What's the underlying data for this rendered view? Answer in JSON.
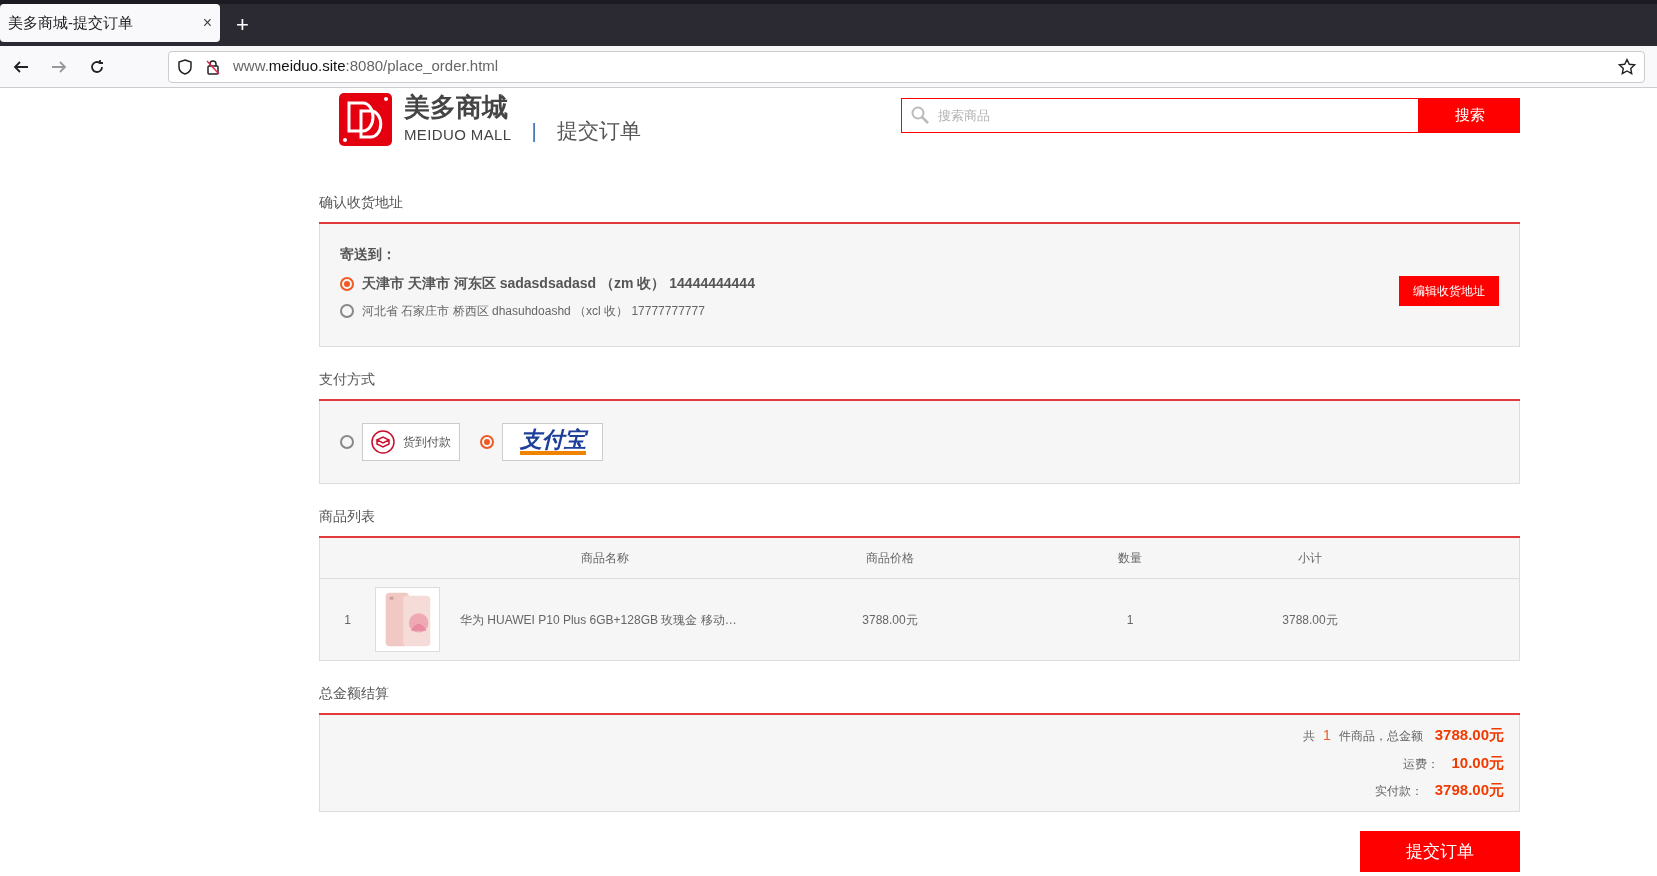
{
  "browser": {
    "tab_title": "美多商城-提交订单",
    "url_prefix": "www.",
    "url_domain": "meiduo.site",
    "url_rest": ":8080/place_order.html",
    "new_tab": "+",
    "close": "×"
  },
  "header": {
    "logo_cn": "美多商城",
    "logo_en": "MEIDUO MALL",
    "separator": "|",
    "page_title": "提交订单",
    "search": {
      "placeholder": "搜索商品",
      "button": "搜索"
    }
  },
  "address": {
    "title": "确认收货地址",
    "send_to": "寄送到：",
    "edit_button": "编辑收货地址",
    "items": [
      {
        "text": "天津市 天津市 河东区 sadasdsadasd （zm 收） 14444444444",
        "selected": true
      },
      {
        "text": "河北省 石家庄市 桥西区 dhasuhdoashd （xcl 收） 17777777777",
        "selected": false
      }
    ]
  },
  "payment": {
    "title": "支付方式",
    "options": [
      {
        "kind": "cod",
        "label": "货到付款",
        "selected": false
      },
      {
        "kind": "alipay",
        "label": "支付宝",
        "selected": true
      }
    ]
  },
  "goods": {
    "title": "商品列表",
    "columns": [
      "商品名称",
      "商品价格",
      "数量",
      "小计"
    ],
    "rows": [
      {
        "index": "1",
        "name": "华为 HUAWEI P10 Plus 6GB+128GB 玫瑰金 移动…",
        "price": "3788.00元",
        "count": "1",
        "subtotal": "3788.00元"
      }
    ]
  },
  "summary": {
    "title": "总金额结算",
    "rows": [
      {
        "kind": "count",
        "prefix": "共",
        "count": "1",
        "suffix": "件商品，总金额",
        "amount": "3788.00元"
      },
      {
        "kind": "plain",
        "label": "运费：",
        "amount": "10.00元"
      },
      {
        "kind": "plain",
        "label": "实付款：",
        "amount": "3798.00元"
      }
    ]
  },
  "submit": "提交订单"
}
